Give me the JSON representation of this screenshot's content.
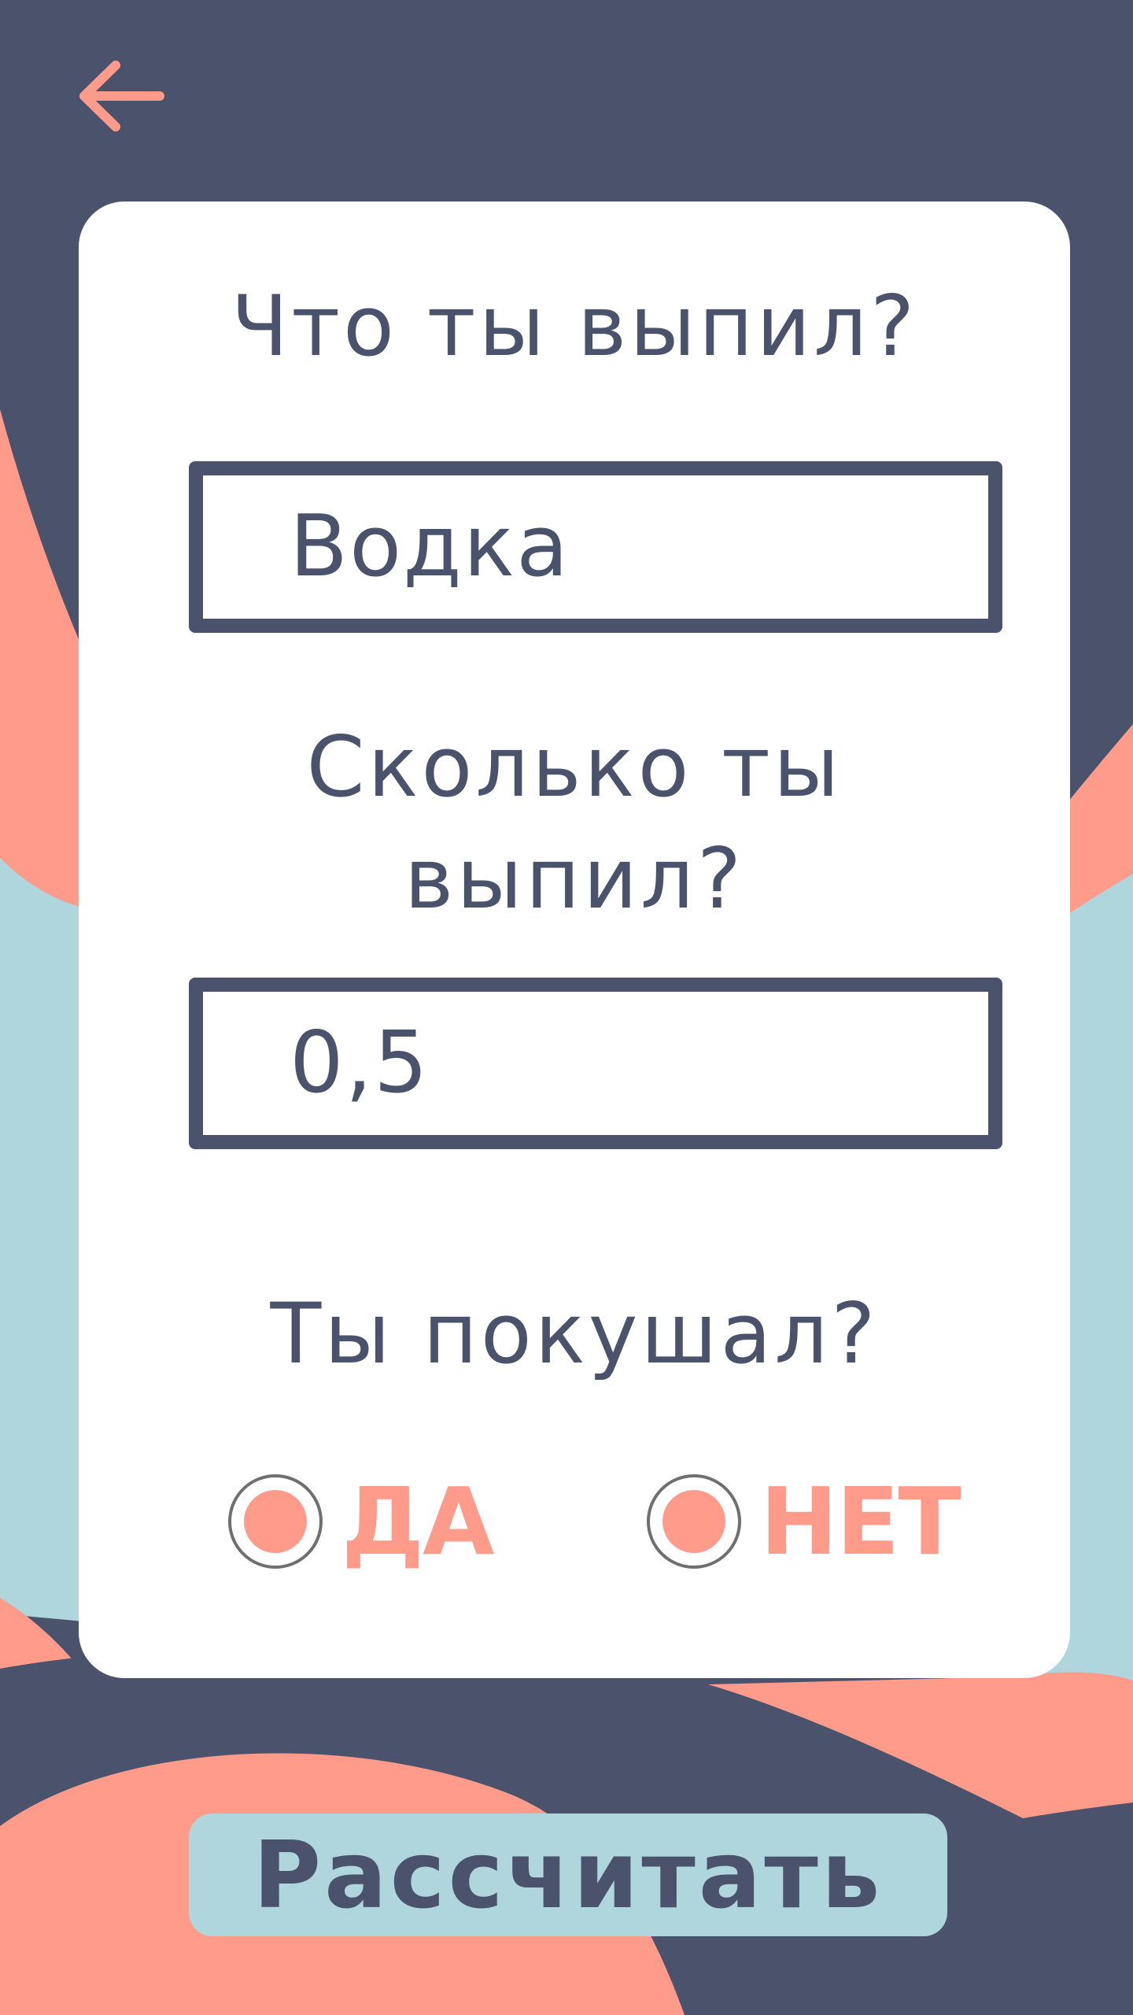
{
  "colors": {
    "navy": "#4b526b",
    "coral": "#fe9b8b",
    "light_blue": "#afd5dd",
    "card": "#ffffff"
  },
  "header": {
    "back_icon": "arrow-left-icon"
  },
  "form": {
    "drink_question": "Что ты выпил?",
    "drink_value": "Водка",
    "amount_question": "Сколько ты выпил?",
    "amount_value": "0,5",
    "ate_question": "Ты покушал?",
    "option_yes": "ДА",
    "option_no": "НЕТ"
  },
  "actions": {
    "calculate_label": "Рассчитать"
  }
}
